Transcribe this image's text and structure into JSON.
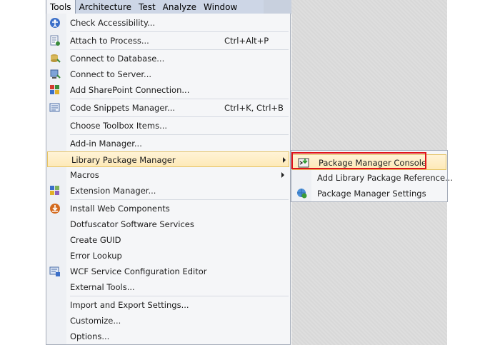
{
  "menubar": {
    "items": [
      {
        "label": "Tools"
      },
      {
        "label": "Architecture"
      },
      {
        "label": "Test"
      },
      {
        "label": "Analyze"
      },
      {
        "label": "Window"
      }
    ]
  },
  "tools_menu": {
    "items": [
      {
        "label": "Check Accessibility...",
        "shortcut": "",
        "icon": "accessibility-icon"
      },
      {
        "label": "Attach to Process...",
        "shortcut": "Ctrl+Alt+P",
        "icon": "attach-process-icon"
      },
      {
        "label": "Connect to Database...",
        "shortcut": "",
        "icon": "database-icon"
      },
      {
        "label": "Connect to Server...",
        "shortcut": "",
        "icon": "server-icon"
      },
      {
        "label": "Add SharePoint Connection...",
        "shortcut": "",
        "icon": "sharepoint-icon"
      },
      {
        "label": "Code Snippets Manager...",
        "shortcut": "Ctrl+K, Ctrl+B",
        "icon": "snippets-icon"
      },
      {
        "label": "Choose Toolbox Items...",
        "shortcut": "",
        "icon": ""
      },
      {
        "label": "Add-in Manager...",
        "shortcut": "",
        "icon": ""
      },
      {
        "label": "Library Package Manager",
        "shortcut": "",
        "icon": ""
      },
      {
        "label": "Macros",
        "shortcut": "",
        "icon": ""
      },
      {
        "label": "Extension Manager...",
        "shortcut": "",
        "icon": "extension-icon"
      },
      {
        "label": "Install Web Components",
        "shortcut": "",
        "icon": "web-components-icon"
      },
      {
        "label": "Dotfuscator Software Services",
        "shortcut": "",
        "icon": ""
      },
      {
        "label": "Create GUID",
        "shortcut": "",
        "icon": ""
      },
      {
        "label": "Error Lookup",
        "shortcut": "",
        "icon": ""
      },
      {
        "label": "WCF Service Configuration Editor",
        "shortcut": "",
        "icon": "wcf-icon"
      },
      {
        "label": "External Tools...",
        "shortcut": "",
        "icon": ""
      },
      {
        "label": "Import and Export Settings...",
        "shortcut": "",
        "icon": ""
      },
      {
        "label": "Customize...",
        "shortcut": "",
        "icon": ""
      },
      {
        "label": "Options...",
        "shortcut": "",
        "icon": ""
      }
    ]
  },
  "submenu": {
    "items": [
      {
        "label": "Package Manager Console",
        "icon": "console-icon"
      },
      {
        "label": "Add Library Package Reference...",
        "icon": ""
      },
      {
        "label": "Package Manager Settings",
        "icon": "settings-globe-icon"
      }
    ]
  },
  "colors": {
    "highlight_border": "#e5c365",
    "callout": "#e0141a"
  }
}
